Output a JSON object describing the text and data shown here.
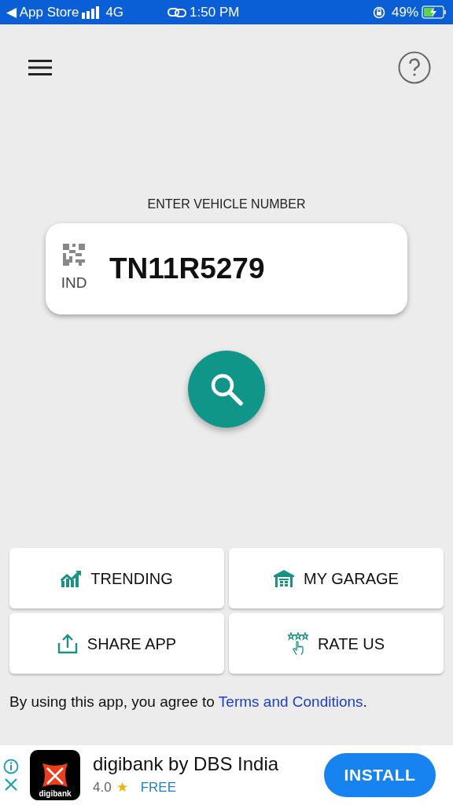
{
  "status_bar": {
    "back": "◀ App Store",
    "network": "4G",
    "time": "1:50 PM",
    "battery": "49%"
  },
  "prompt": "ENTER VEHICLE NUMBER",
  "plate": {
    "country": "IND",
    "value": "TN11R5279"
  },
  "tiles": [
    {
      "kind": "trending",
      "label": "TRENDING"
    },
    {
      "kind": "garage",
      "label": "MY GARAGE"
    },
    {
      "kind": "share",
      "label": "SHARE APP"
    },
    {
      "kind": "rate",
      "label": "RATE US"
    }
  ],
  "terms": {
    "text": "By using this app, you agree to ",
    "link": "Terms and Conditions",
    "end": "."
  },
  "ad": {
    "logo_text": "digibank",
    "title": "digibank by DBS India",
    "rating": "4.0",
    "star": "★",
    "price": "FREE",
    "button": "INSTALL"
  }
}
